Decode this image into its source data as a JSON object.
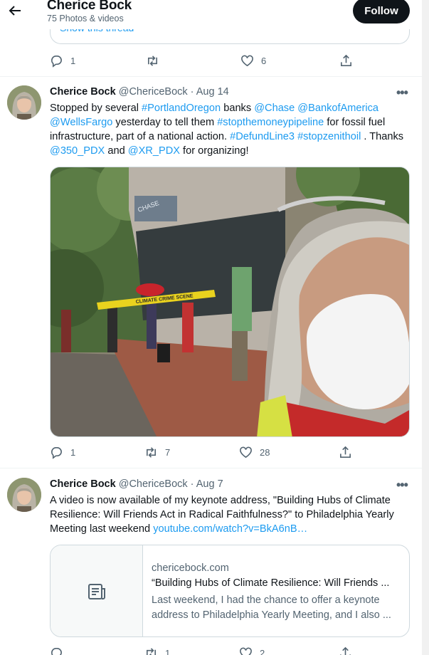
{
  "header": {
    "title": "Cherice Bock",
    "subtitle": "75 Photos & videos",
    "follow_label": "Follow"
  },
  "prev_tweet": {
    "show_thread": "Show this thread",
    "replies": "1",
    "retweets": "",
    "likes": "6"
  },
  "tweet1": {
    "name": "Cherice Bock",
    "handle": "@ChericeBock",
    "dot": "·",
    "date": "Aug 14",
    "more": "•••",
    "text": [
      {
        "t": "Stopped by several ",
        "link": false
      },
      {
        "t": "#PortlandOregon",
        "link": true
      },
      {
        "t": " banks ",
        "link": false
      },
      {
        "t": "@Chase",
        "link": true
      },
      {
        "t": " ",
        "link": false
      },
      {
        "t": "@BankofAmerica",
        "link": true
      },
      {
        "t": " ",
        "link": false
      },
      {
        "t": "@WellsFargo",
        "link": true
      },
      {
        "t": " yesterday to tell them ",
        "link": false
      },
      {
        "t": "#stopthemoneypipeline",
        "link": true
      },
      {
        "t": " for fossil fuel infrastructure, part of a national action. ",
        "link": false
      },
      {
        "t": "#DefundLine3",
        "link": true
      },
      {
        "t": " ",
        "link": false
      },
      {
        "t": "#stopzenithoil",
        "link": true
      },
      {
        "t": " . Thanks ",
        "link": false
      },
      {
        "t": "@350_PDX",
        "link": true
      },
      {
        "t": " and ",
        "link": false
      },
      {
        "t": "@XR_PDX",
        "link": true
      },
      {
        "t": " for organizing!",
        "link": false
      }
    ],
    "photo_signs": {
      "bank_sign": "CHASE",
      "banner": "CLIMATE CRIME SCENE"
    },
    "replies": "1",
    "retweets": "7",
    "likes": "28"
  },
  "tweet2": {
    "name": "Cherice Bock",
    "handle": "@ChericeBock",
    "dot": "·",
    "date": "Aug 7",
    "more": "•••",
    "text_plain": "A video is now available of my keynote address, \"Building Hubs of Climate Resilience: Will Friends Act in Radical Faithfulness?\" to Philadelphia Yearly Meeting last weekend ",
    "text_link": "youtube.com/watch?v=BkA6nB…",
    "card": {
      "domain": "chericebock.com",
      "title": "“Building Hubs of Climate Resilience: Will Friends ...",
      "desc_line1": "Last weekend, I had the chance to offer a keynote",
      "desc_line2": "address to Philadelphia Yearly Meeting, and I also ..."
    },
    "replies": "",
    "retweets": "1",
    "likes": "2"
  },
  "colors": {
    "accent": "#1d9bf0",
    "text": "#0f1419",
    "muted": "#536471",
    "border": "#cfd9de",
    "follow_bg": "#0f1419"
  },
  "icons": [
    "back-arrow-icon",
    "reply-icon",
    "retweet-icon",
    "like-icon",
    "share-icon",
    "more-icon",
    "article-icon"
  ]
}
